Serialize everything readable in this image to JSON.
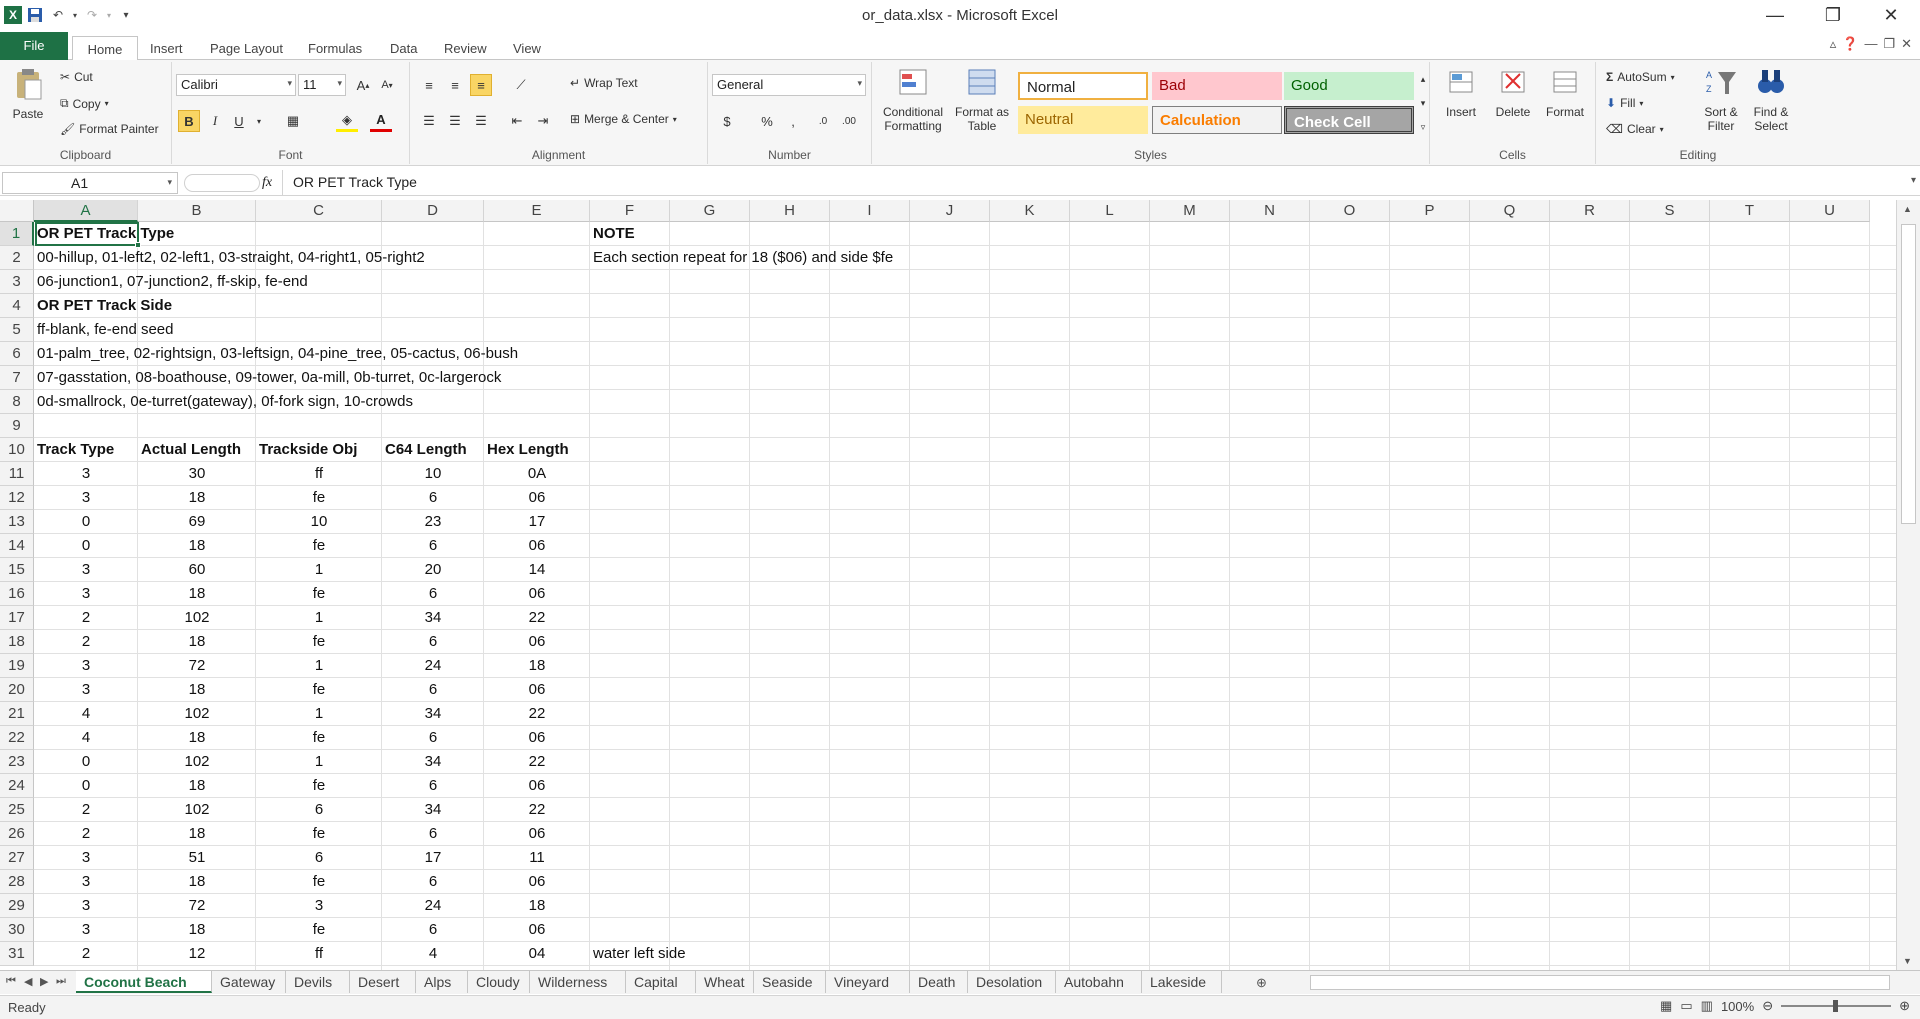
{
  "window": {
    "title": "or_data.xlsx - Microsoft Excel",
    "minimize": "—",
    "restore": "❐",
    "close": "✕"
  },
  "ribbon_tabs": [
    "File",
    "Home",
    "Insert",
    "Page Layout",
    "Formulas",
    "Data",
    "Review",
    "View"
  ],
  "ribbon": {
    "clipboard": {
      "paste": "Paste",
      "cut": "Cut",
      "copy": "Copy",
      "format_painter": "Format Painter",
      "label": "Clipboard"
    },
    "font": {
      "name": "Calibri",
      "size": "11",
      "label": "Font"
    },
    "alignment": {
      "wrap_text": "Wrap Text",
      "merge_center": "Merge & Center",
      "label": "Alignment"
    },
    "number": {
      "format": "General",
      "label": "Number"
    },
    "styles": {
      "conditional": "Conditional Formatting",
      "format_table": "Format as Table",
      "cells": [
        "Normal",
        "Bad",
        "Good",
        "Neutral",
        "Calculation",
        "Check Cell"
      ],
      "label": "Styles"
    },
    "cells": {
      "insert": "Insert",
      "delete": "Delete",
      "format": "Format",
      "label": "Cells"
    },
    "editing": {
      "autosum": "AutoSum",
      "fill": "Fill",
      "clear": "Clear",
      "sort_filter": "Sort & Filter",
      "find_select": "Find & Select",
      "label": "Editing"
    }
  },
  "formula_bar": {
    "name_box": "A1",
    "fx": "fx",
    "content": "OR PET Track Type"
  },
  "columns": [
    "A",
    "B",
    "C",
    "D",
    "E",
    "F",
    "G",
    "H",
    "I",
    "J",
    "K",
    "L",
    "M",
    "N",
    "O",
    "P",
    "Q",
    "R",
    "S",
    "T",
    "U"
  ],
  "rows": [
    "1",
    "2",
    "3",
    "4",
    "5",
    "6",
    "7",
    "8",
    "9",
    "10",
    "11",
    "12",
    "13",
    "14",
    "15",
    "16",
    "17",
    "18",
    "19",
    "20",
    "21",
    "22",
    "23",
    "24",
    "25",
    "26",
    "27",
    "28",
    "29",
    "30",
    "31"
  ],
  "notes": {
    "a1": "OR PET Track Type",
    "a2": "00-hillup, 01-left2, 02-left1, 03-straight, 04-right1, 05-right2",
    "a3": "06-junction1, 07-junction2, ff-skip, fe-end",
    "a4": "OR PET Track Side",
    "a5": "ff-blank, fe-end seed",
    "a6": "01-palm_tree, 02-rightsign, 03-leftsign, 04-pine_tree, 05-cactus, 06-bush",
    "a7": "07-gasstation, 08-boathouse, 09-tower, 0a-mill, 0b-turret, 0c-largerock",
    "a8": "0d-smallrock, 0e-turret(gateway), 0f-fork sign, 10-crowds",
    "f1": "NOTE",
    "f2": "Each section repeat for 18 ($06) and side $fe",
    "f31": "water left side"
  },
  "table_headers": [
    "Track Type",
    "Actual Length",
    "Trackside Obj",
    "C64 Length",
    "Hex Length"
  ],
  "table_rows": [
    [
      "3",
      "30",
      "ff",
      "10",
      "0A"
    ],
    [
      "3",
      "18",
      "fe",
      "6",
      "06"
    ],
    [
      "0",
      "69",
      "10",
      "23",
      "17"
    ],
    [
      "0",
      "18",
      "fe",
      "6",
      "06"
    ],
    [
      "3",
      "60",
      "1",
      "20",
      "14"
    ],
    [
      "3",
      "18",
      "fe",
      "6",
      "06"
    ],
    [
      "2",
      "102",
      "1",
      "34",
      "22"
    ],
    [
      "2",
      "18",
      "fe",
      "6",
      "06"
    ],
    [
      "3",
      "72",
      "1",
      "24",
      "18"
    ],
    [
      "3",
      "18",
      "fe",
      "6",
      "06"
    ],
    [
      "4",
      "102",
      "1",
      "34",
      "22"
    ],
    [
      "4",
      "18",
      "fe",
      "6",
      "06"
    ],
    [
      "0",
      "102",
      "1",
      "34",
      "22"
    ],
    [
      "0",
      "18",
      "fe",
      "6",
      "06"
    ],
    [
      "2",
      "102",
      "6",
      "34",
      "22"
    ],
    [
      "2",
      "18",
      "fe",
      "6",
      "06"
    ],
    [
      "3",
      "51",
      "6",
      "17",
      "11"
    ],
    [
      "3",
      "18",
      "fe",
      "6",
      "06"
    ],
    [
      "3",
      "72",
      "3",
      "24",
      "18"
    ],
    [
      "3",
      "18",
      "fe",
      "6",
      "06"
    ],
    [
      "2",
      "12",
      "ff",
      "4",
      "04"
    ]
  ],
  "sheet_tabs": [
    "Coconut Beach",
    "Gateway",
    "Devils",
    "Desert",
    "Alps",
    "Cloudy",
    "Wilderness",
    "Capital",
    "Wheat",
    "Seaside",
    "Vineyard",
    "Death",
    "Desolation",
    "Autobahn",
    "Lakeside"
  ],
  "status": {
    "ready": "Ready",
    "zoom": "100%"
  },
  "colors": {
    "excel_green": "#217346",
    "file_tab": "#1e7145"
  }
}
